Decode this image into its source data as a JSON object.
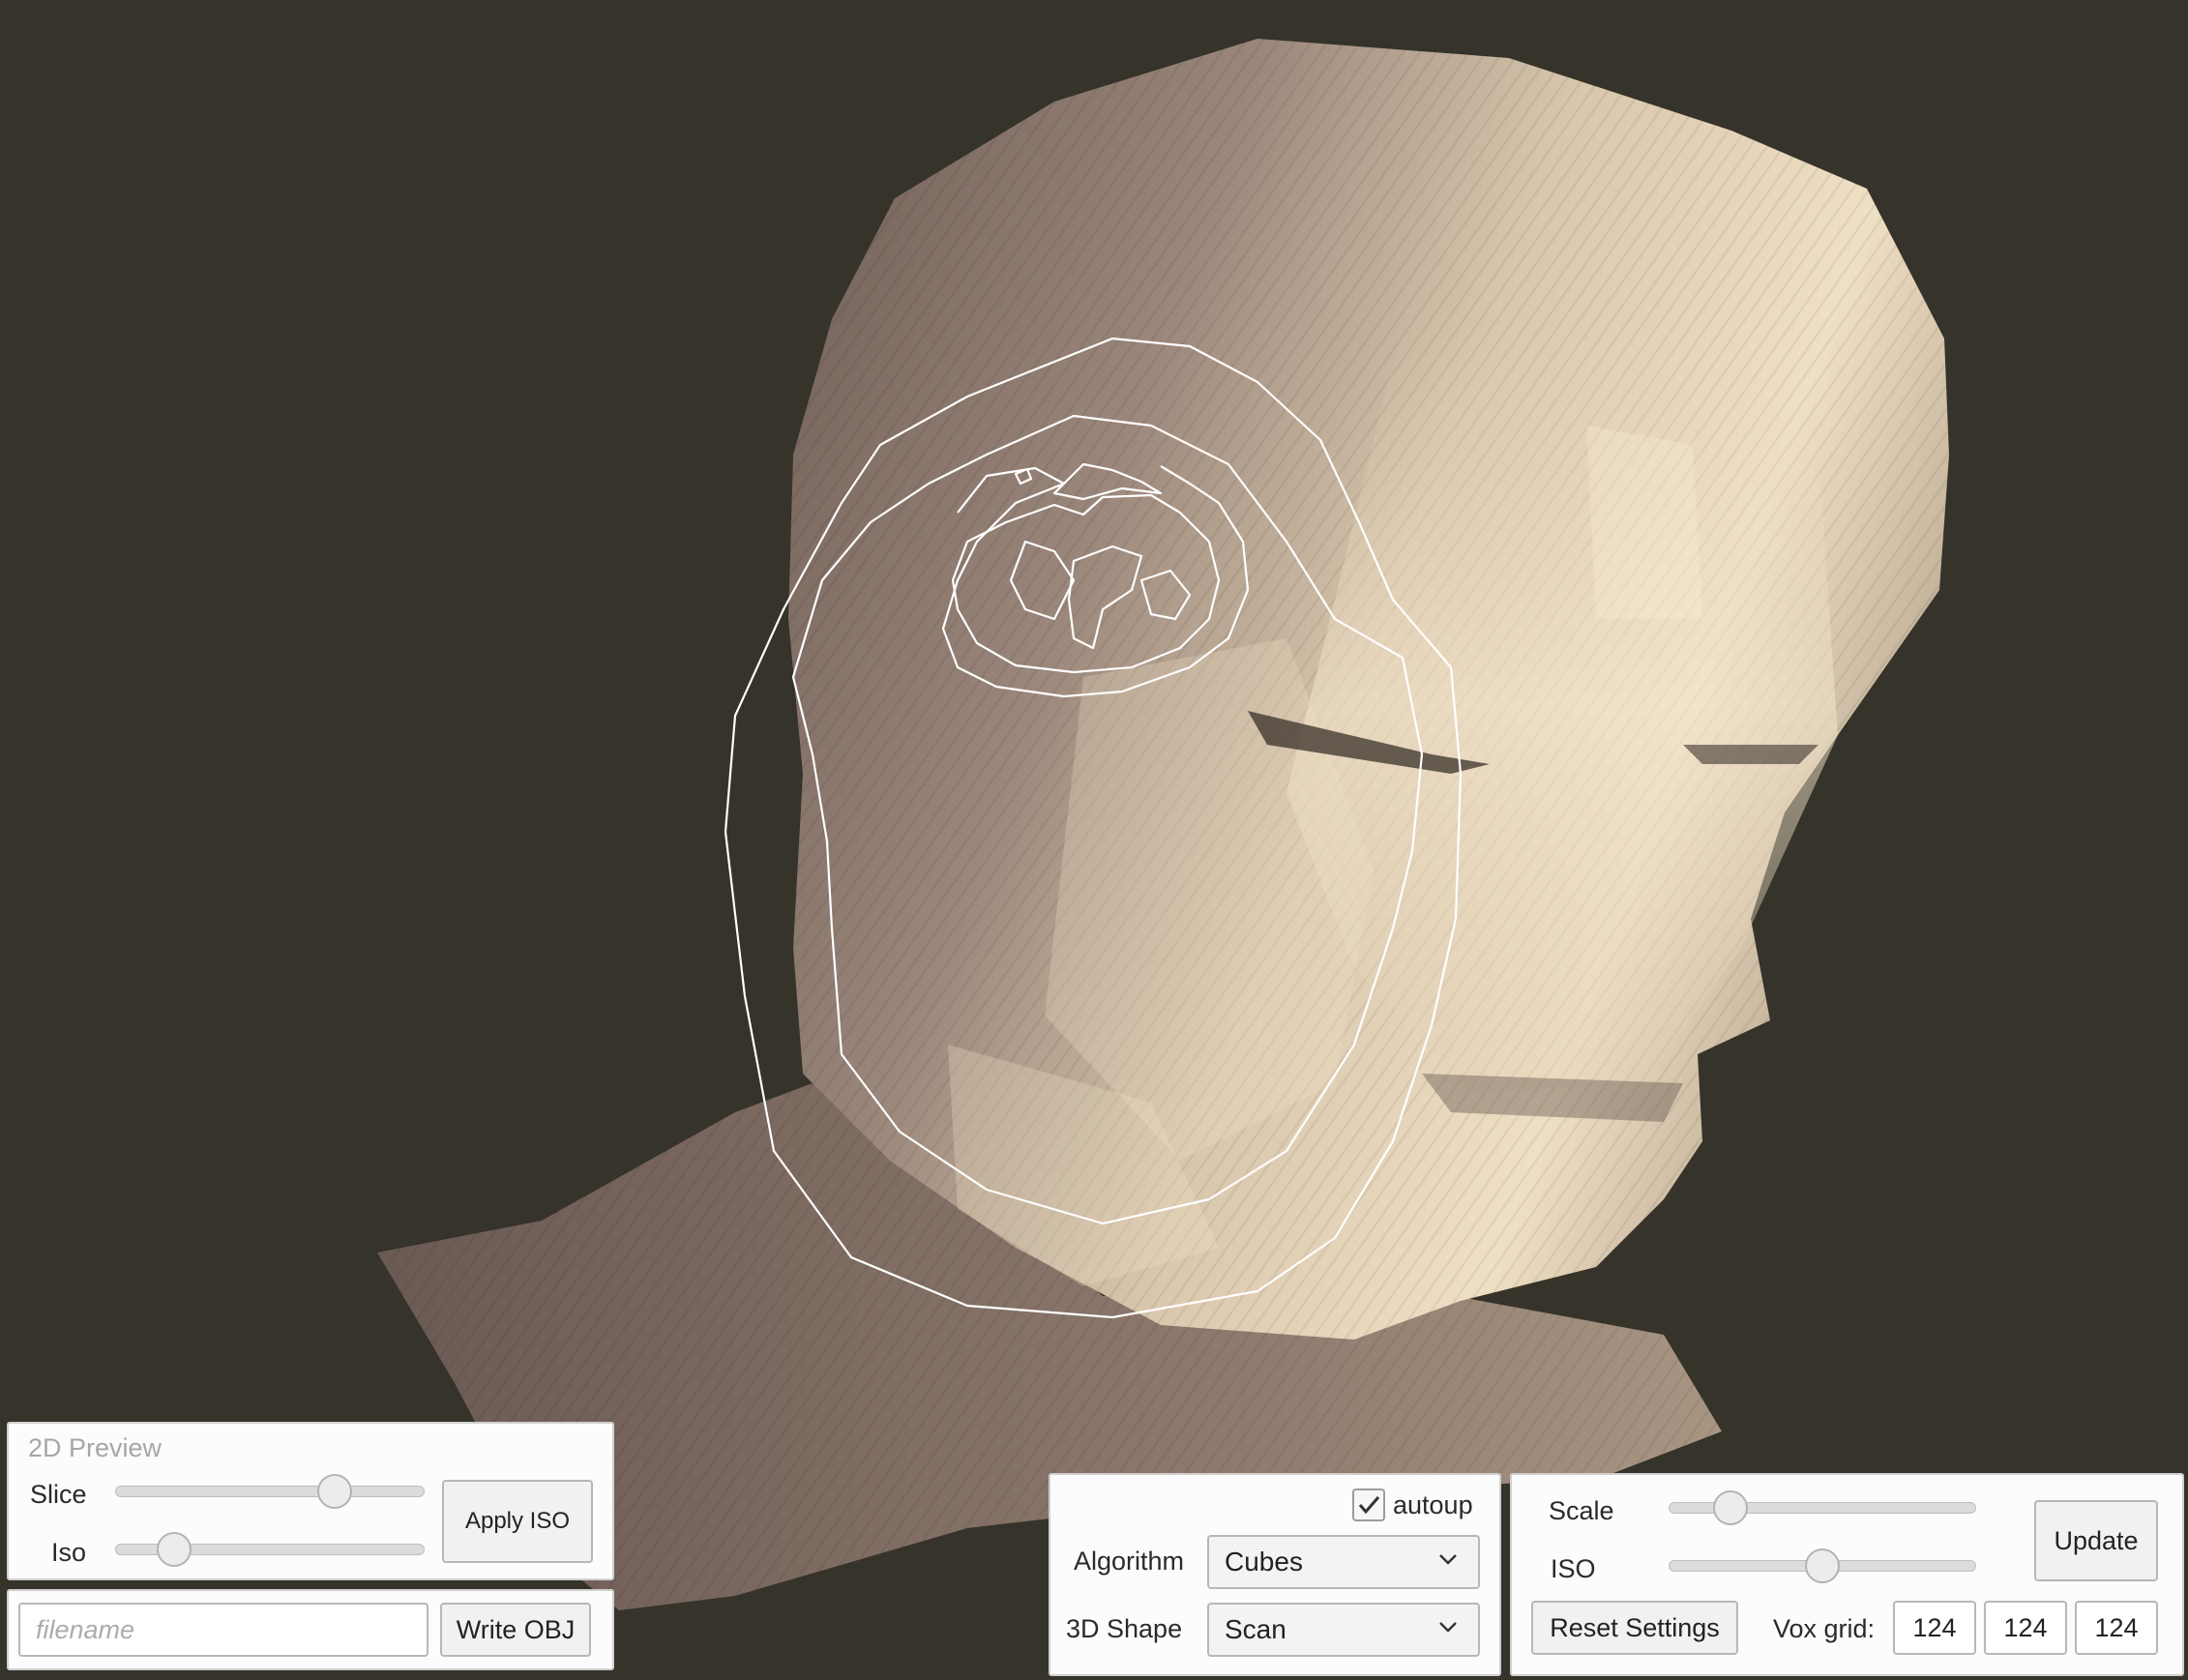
{
  "viewport": {
    "subject": "3D head scan mesh",
    "background": "#35332a",
    "mesh_light": "#f2e3c6",
    "mesh_dark": "#6a5852",
    "contour_color": "#ffffff"
  },
  "preview_panel": {
    "title": "2D Preview",
    "slice_label": "Slice",
    "slice_value": 0.71,
    "iso_label": "Iso",
    "iso_value": 0.19,
    "apply_button": "Apply ISO"
  },
  "export_panel": {
    "filename_placeholder": "filename",
    "write_button": "Write OBJ"
  },
  "algorithm_panel": {
    "autoup_label": "autoup",
    "autoup_checked": true,
    "algorithm_label": "Algorithm",
    "algorithm_value": "Cubes",
    "shape_label": "3D Shape",
    "shape_value": "Scan"
  },
  "settings_panel": {
    "scale_label": "Scale",
    "scale_value": 0.2,
    "iso_label": "ISO",
    "iso_value": 0.5,
    "update_button": "Update",
    "reset_button": "Reset Settings",
    "vox_grid_label": "Vox grid:",
    "vox_grid": [
      "124",
      "124",
      "124"
    ]
  }
}
